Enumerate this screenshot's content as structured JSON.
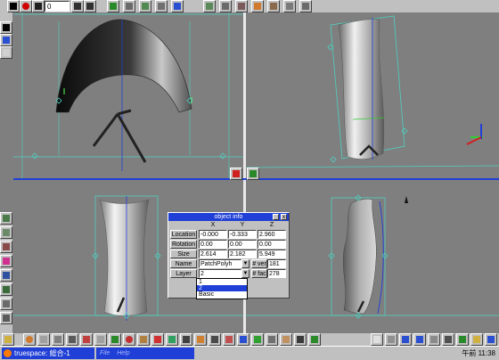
{
  "top_toolbar": {
    "frame_value": "0"
  },
  "object_info": {
    "title": "object info",
    "close_glyph": "x",
    "columns": [
      "X",
      "Y",
      "Z"
    ],
    "rows": [
      {
        "label": "Location",
        "values": [
          "-0.000",
          "-0.333",
          "2.960"
        ]
      },
      {
        "label": "Rotation",
        "values": [
          "0.00",
          "0.00",
          "0.00"
        ]
      },
      {
        "label": "Size",
        "values": [
          "2.614",
          "2.182",
          "5.949"
        ]
      }
    ],
    "name_label": "Name",
    "name_value": "PatchPolyh",
    "verts_label": "# ver",
    "verts_value": "181",
    "layer_label": "Layer",
    "layer_value": "2",
    "faces_label": "# fac",
    "faces_value": "278",
    "layer_options": [
      "1",
      "2",
      "Basic"
    ],
    "layer_selected": "2"
  },
  "taskbar": {
    "task_label": "truespace: 総合-1",
    "menu_items": [
      "File",
      "Help"
    ],
    "clock": "午前 11:38"
  },
  "colors": {
    "background": "#7f7f7f",
    "panel": "#c0c0c0",
    "title_bar": "#1f3fd6",
    "bounding_box": "#4fd0c0"
  }
}
